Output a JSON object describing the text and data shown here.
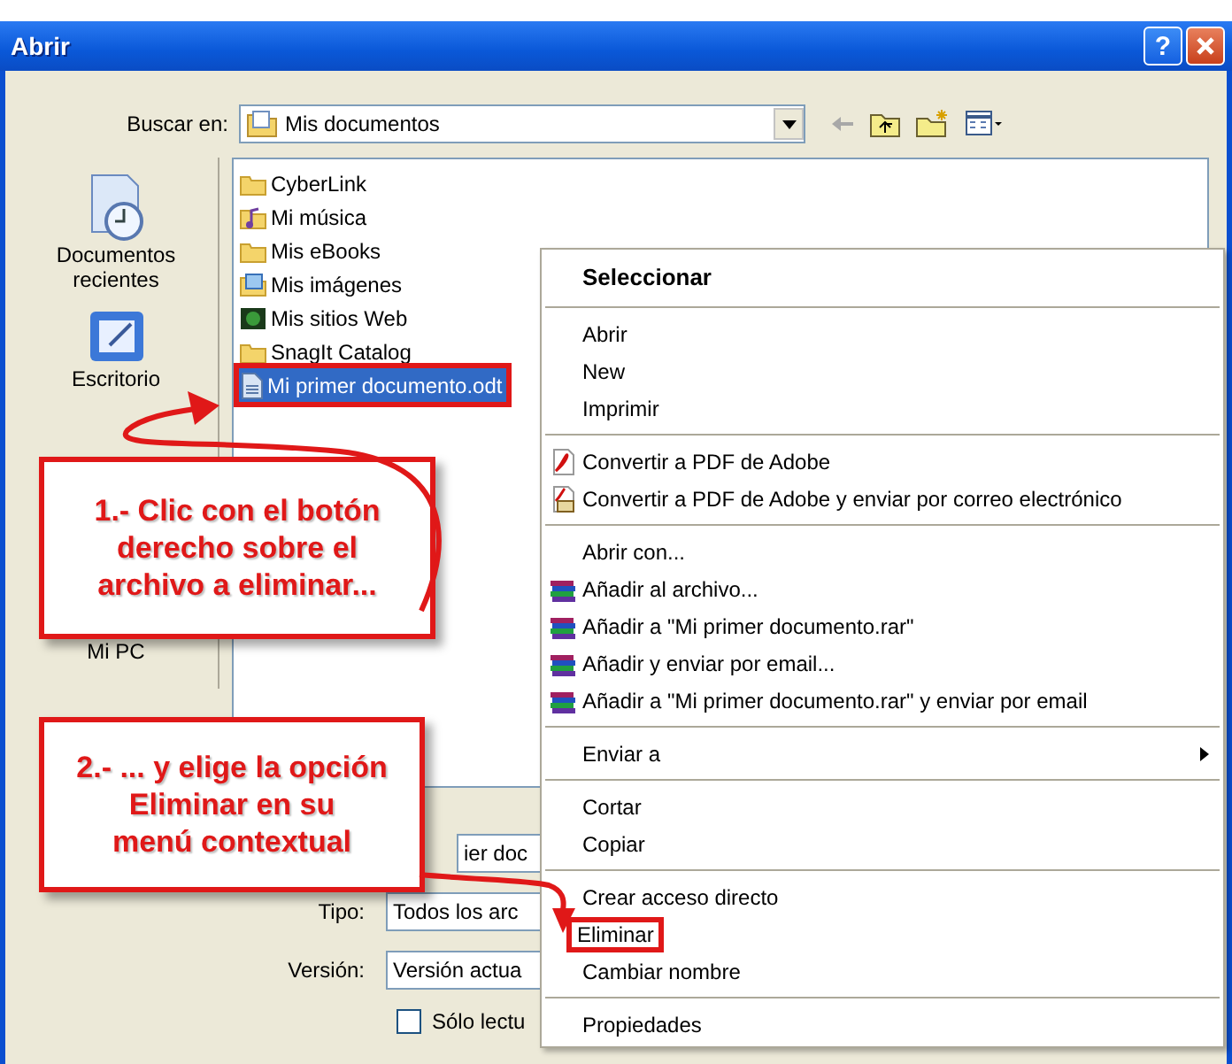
{
  "window": {
    "title": "Abrir",
    "help_button": "?"
  },
  "look_in": {
    "label": "Buscar en:",
    "value": "Mis documentos"
  },
  "places": [
    {
      "label": "Documentos recientes",
      "kind": "recent"
    },
    {
      "label": "Escritorio",
      "kind": "desktop"
    },
    {
      "label": "Mi PC",
      "kind": "computer"
    }
  ],
  "files": [
    {
      "name": "CyberLink",
      "kind": "folder",
      "selected": false,
      "annotated": false
    },
    {
      "name": "Mi música",
      "kind": "music",
      "selected": false,
      "annotated": false
    },
    {
      "name": "Mis eBooks",
      "kind": "folder",
      "selected": false,
      "annotated": false
    },
    {
      "name": "Mis imágenes",
      "kind": "pictures",
      "selected": false,
      "annotated": false
    },
    {
      "name": "Mis sitios Web",
      "kind": "web",
      "selected": false,
      "annotated": false
    },
    {
      "name": "SnagIt Catalog",
      "kind": "folder",
      "selected": false,
      "annotated": false
    },
    {
      "name": "Mi primer documento.odt",
      "kind": "document",
      "selected": true,
      "annotated": true
    }
  ],
  "form": {
    "file_name": "ier doc",
    "type_label": "Tipo:",
    "type_value": "Todos los arc",
    "version_label": "Versión:",
    "version_value": "Versión actua",
    "read_only": {
      "label": "Sólo lectu",
      "checked": false
    }
  },
  "context_menu": [
    {
      "kind": "header",
      "label": "Seleccionar"
    },
    {
      "kind": "separator"
    },
    {
      "kind": "plain",
      "label": "Abrir",
      "annotated": false
    },
    {
      "kind": "plain",
      "label": "New",
      "annotated": false
    },
    {
      "kind": "plain",
      "label": "Imprimir",
      "annotated": false
    },
    {
      "kind": "separator"
    },
    {
      "kind": "pdf",
      "label": "Convertir a PDF de Adobe",
      "annotated": false
    },
    {
      "kind": "pdf-mail",
      "label": "Convertir a PDF de Adobe y enviar por correo electrónico",
      "annotated": false
    },
    {
      "kind": "separator"
    },
    {
      "kind": "plain",
      "label": "Abrir con...",
      "annotated": false
    },
    {
      "kind": "archive",
      "label": "Añadir al archivo...",
      "annotated": false
    },
    {
      "kind": "archive",
      "label": "Añadir a \"Mi primer documento.rar\"",
      "annotated": false
    },
    {
      "kind": "archive",
      "label": "Añadir y enviar por email...",
      "annotated": false
    },
    {
      "kind": "archive",
      "label": "Añadir a \"Mi primer documento.rar\" y enviar por email",
      "annotated": false
    },
    {
      "kind": "separator"
    },
    {
      "kind": "submenu",
      "label": "Enviar a",
      "annotated": false
    },
    {
      "kind": "separator"
    },
    {
      "kind": "plain",
      "label": "Cortar",
      "annotated": false
    },
    {
      "kind": "plain",
      "label": "Copiar",
      "annotated": false
    },
    {
      "kind": "separator"
    },
    {
      "kind": "plain",
      "label": "Crear acceso directo",
      "annotated": false
    },
    {
      "kind": "plain",
      "label": "Eliminar",
      "annotated": true
    },
    {
      "kind": "plain",
      "label": "Cambiar nombre",
      "annotated": false
    },
    {
      "kind": "separator"
    },
    {
      "kind": "plain",
      "label": "Propiedades",
      "annotated": false
    }
  ],
  "callouts": [
    "1.- Clic con el botón\nderecho sobre el\narchivo a eliminar...",
    "2.- ... y elige la opción\nEliminar  en su\nmenú contextual"
  ]
}
